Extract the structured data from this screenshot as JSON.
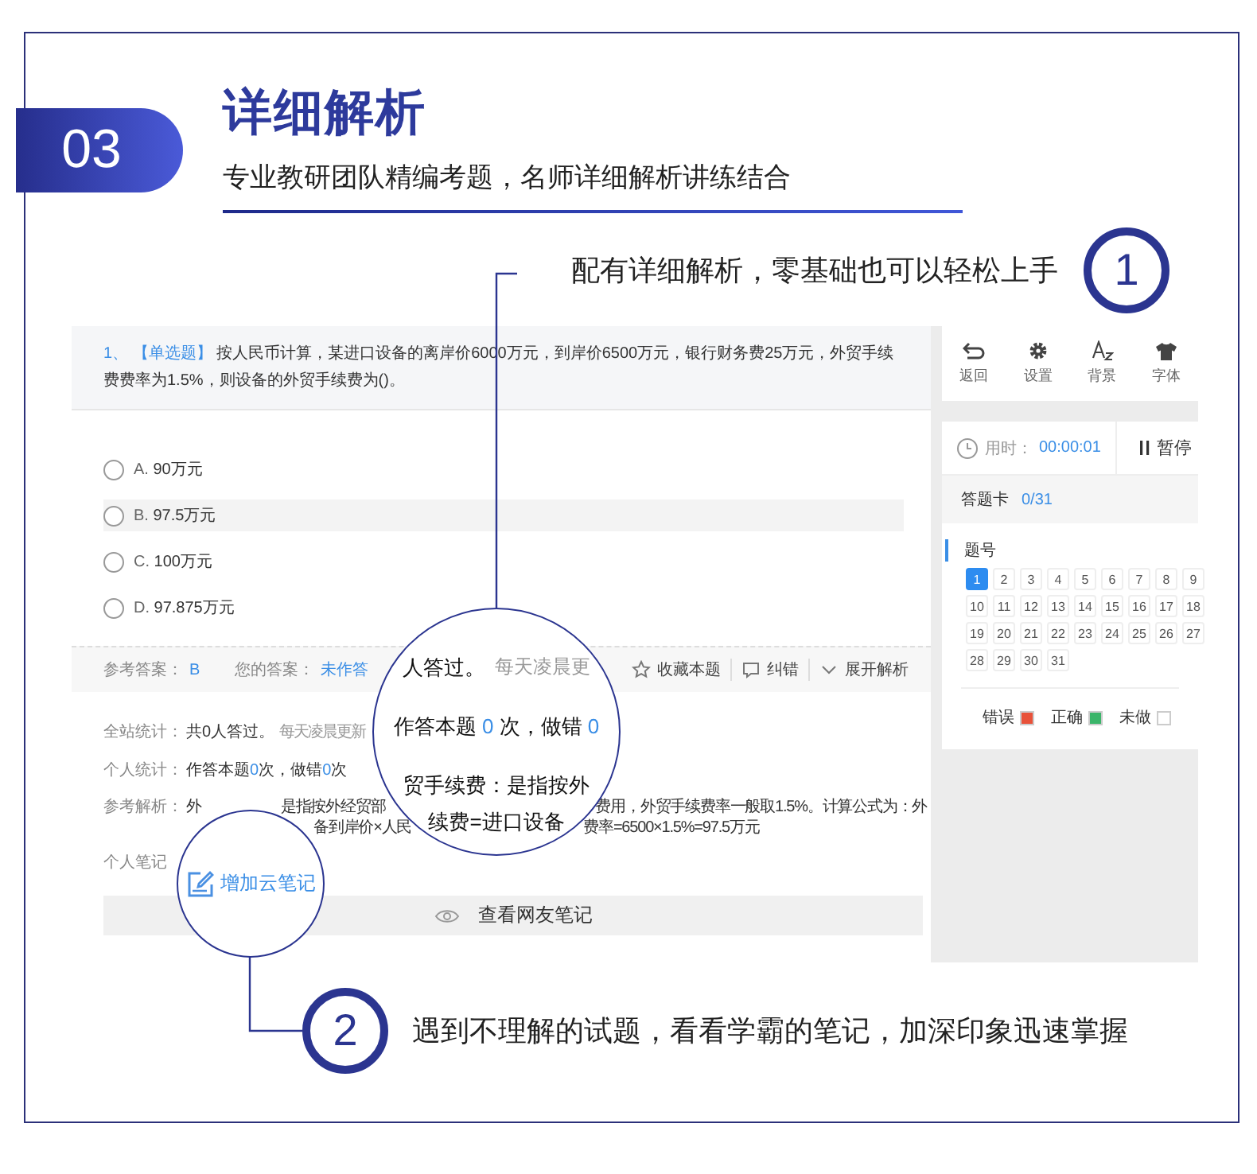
{
  "badge": "03",
  "title": "详细解析",
  "subtitle": "专业教研团队精编考题，名师详细解析讲练结合",
  "callouts": [
    {
      "number": "1",
      "text": "配有详细解析，零基础也可以轻松上手"
    },
    {
      "number": "2",
      "text": "遇到不理解的试题，看看学霸的笔记，加深印象迅速掌握"
    }
  ],
  "question": {
    "index": "1、",
    "type": "【单选题】",
    "text": "按人民币计算，某进口设备的离岸价6000万元，到岸价6500万元，银行财务费25万元，外贸手续费费率为1.5%，则设备的外贸手续费为()。"
  },
  "options": [
    {
      "letter": "A.",
      "text": "90万元",
      "selected": false,
      "highlighted": false
    },
    {
      "letter": "B.",
      "text": "97.5万元",
      "selected": false,
      "highlighted": true
    },
    {
      "letter": "C.",
      "text": "100万元",
      "selected": false,
      "highlighted": false
    },
    {
      "letter": "D.",
      "text": "97.875万元",
      "selected": false,
      "highlighted": false
    }
  ],
  "answer_bar": {
    "reference_label": "参考答案：",
    "reference": "B",
    "yours_label": "您的答案：",
    "yours": "未作答",
    "actions": [
      {
        "kind": "star",
        "label": "收藏本题"
      },
      {
        "kind": "comment",
        "label": "纠错"
      },
      {
        "kind": "chevron",
        "label": "展开解析"
      }
    ]
  },
  "stats": {
    "site_label": "全站统计：",
    "site_text": "共0人答过。",
    "site_note": "每天凌晨更新",
    "personal_label": "个人统计：",
    "personal": {
      "answered_label": "作答本题",
      "answered": "0",
      "wrong_label": "次，做错",
      "wrong": "0",
      "suffix": "次"
    },
    "analysis_label": "参考解析：",
    "analysis_lines": [
      [
        "外",
        "是指按外经贸部",
        "费用，外贸手续费率一般取1.5%。计算公式为：外"
      ],
      [
        "备到岸价×人民",
        "费率=6500×1.5%=97.5万元"
      ]
    ],
    "note_label": "个人笔记"
  },
  "notes_button": "查看网友笔记",
  "magnifier": {
    "answered_text": "人答过。",
    "note": "每天凌晨更",
    "answered_label": "作答本题",
    "answered": "0",
    "wrong_label": "次，做错",
    "wrong": "0",
    "line_3": "贸手续费：是指按外",
    "line_4": "续费=进口设备"
  },
  "add_note": "增加云笔记",
  "sidebar": {
    "tools": [
      {
        "kind": "back",
        "label": "返回"
      },
      {
        "kind": "gear",
        "label": "设置"
      },
      {
        "kind": "font",
        "label": "背景"
      },
      {
        "kind": "shirt",
        "label": "字体"
      }
    ],
    "timer_label": "用时：",
    "timer": "00:00:01",
    "pause": "暂停",
    "card_title": "答题卡",
    "card_count": "0/31",
    "numbers_title": "题号",
    "numbers": [
      {
        "label": "1",
        "selected": true
      },
      {
        "label": "2",
        "selected": false
      },
      {
        "label": "3",
        "selected": false
      },
      {
        "label": "4",
        "selected": false
      },
      {
        "label": "5",
        "selected": false
      },
      {
        "label": "6",
        "selected": false
      },
      {
        "label": "7",
        "selected": false
      },
      {
        "label": "8",
        "selected": false
      },
      {
        "label": "9",
        "selected": false
      },
      {
        "label": "10",
        "selected": false
      },
      {
        "label": "11",
        "selected": false
      },
      {
        "label": "12",
        "selected": false
      },
      {
        "label": "13",
        "selected": false
      },
      {
        "label": "14",
        "selected": false
      },
      {
        "label": "15",
        "selected": false
      },
      {
        "label": "16",
        "selected": false
      },
      {
        "label": "17",
        "selected": false
      },
      {
        "label": "18",
        "selected": false
      },
      {
        "label": "19",
        "selected": false
      },
      {
        "label": "20",
        "selected": false
      },
      {
        "label": "21",
        "selected": false
      },
      {
        "label": "22",
        "selected": false
      },
      {
        "label": "23",
        "selected": false
      },
      {
        "label": "24",
        "selected": false
      },
      {
        "label": "25",
        "selected": false
      },
      {
        "label": "26",
        "selected": false
      },
      {
        "label": "27",
        "selected": false
      },
      {
        "label": "28",
        "selected": false
      },
      {
        "label": "29",
        "selected": false
      },
      {
        "label": "30",
        "selected": false
      },
      {
        "label": "31",
        "selected": false
      }
    ],
    "legend": [
      {
        "label": "错误",
        "color": "#e8523a"
      },
      {
        "label": "正确",
        "color": "#3bb56a"
      },
      {
        "label": "未做",
        "color": "#ffffff"
      }
    ]
  }
}
